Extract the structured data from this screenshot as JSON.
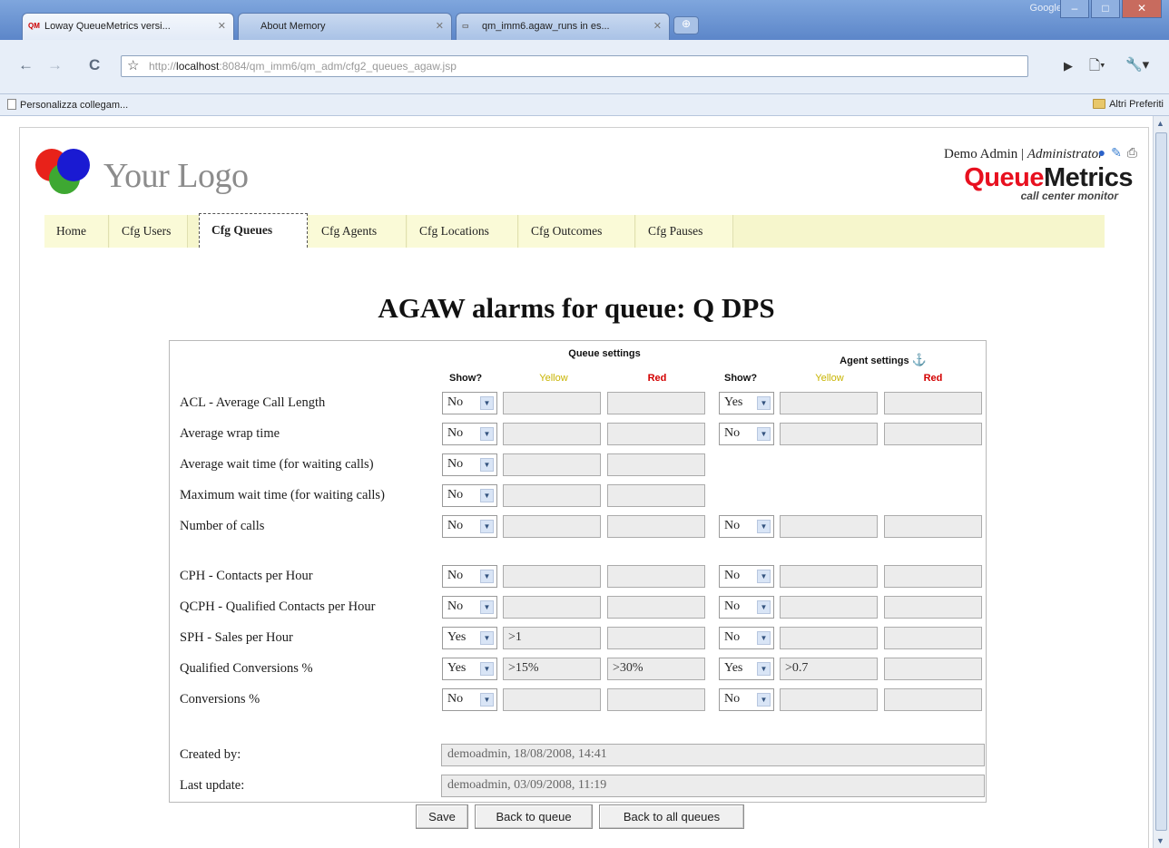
{
  "browser": {
    "tabs": [
      {
        "label": "Loway QueueMetrics versi...",
        "favicon": "QM"
      },
      {
        "label": "About Memory",
        "favicon": ""
      },
      {
        "label": "qm_imm6.agaw_runs in es...",
        "favicon": ""
      }
    ],
    "url_host": "localhost",
    "url_prefix": "http://",
    "url_rest": ":8084/qm_imm6/qm_adm/cfg2_queues_agaw.jsp",
    "brand": "Google",
    "bookmarks_left": "Personalizza collegam...",
    "bookmarks_right": "Altri Preferiti"
  },
  "header": {
    "logo_text": "Your Logo",
    "user_name": "Demo Admin",
    "separator": " | ",
    "user_role": "Administrator",
    "brand_queue": "Queue",
    "brand_metrics": "Metrics",
    "brand_sub": "call center monitor"
  },
  "nav": {
    "tabs": [
      "Home",
      "Cfg Users",
      "Cfg Queues",
      "Cfg Agents",
      "Cfg Locations",
      "Cfg Outcomes",
      "Cfg Pauses"
    ],
    "active": "Cfg Queues"
  },
  "page": {
    "title": "AGAW alarms for queue: Q DPS"
  },
  "form": {
    "queue_settings_label": "Queue settings",
    "agent_settings_label": "Agent settings",
    "show_label": "Show?",
    "yellow_label": "Yellow",
    "red_label": "Red",
    "rows": [
      {
        "label": "ACL - Average Call Length",
        "q_show": "No",
        "q_yellow": "",
        "q_red": "",
        "a_show": "Yes",
        "a_yellow": "",
        "a_red": ""
      },
      {
        "label": "Average wrap time",
        "q_show": "No",
        "q_yellow": "",
        "q_red": "",
        "a_show": "No",
        "a_yellow": "",
        "a_red": ""
      },
      {
        "label": "Average wait time (for waiting calls)",
        "q_show": "No",
        "q_yellow": "",
        "q_red": ""
      },
      {
        "label": "Maximum wait time (for waiting calls)",
        "q_show": "No",
        "q_yellow": "",
        "q_red": ""
      },
      {
        "label": "Number of calls",
        "q_show": "No",
        "q_yellow": "",
        "q_red": "",
        "a_show": "No",
        "a_yellow": "",
        "a_red": ""
      },
      {
        "label": "CPH - Contacts per Hour",
        "q_show": "No",
        "q_yellow": "",
        "q_red": "",
        "a_show": "No",
        "a_yellow": "",
        "a_red": ""
      },
      {
        "label": "QCPH - Qualified Contacts per Hour",
        "q_show": "No",
        "q_yellow": "",
        "q_red": "",
        "a_show": "No",
        "a_yellow": "",
        "a_red": ""
      },
      {
        "label": "SPH - Sales per Hour",
        "q_show": "Yes",
        "q_yellow": ">1",
        "q_red": "",
        "a_show": "No",
        "a_yellow": "",
        "a_red": ""
      },
      {
        "label": "Qualified Conversions %",
        "q_show": "Yes",
        "q_yellow": ">15%",
        "q_red": ">30%",
        "a_show": "Yes",
        "a_yellow": ">0.7",
        "a_red": ""
      },
      {
        "label": "Conversions %",
        "q_show": "No",
        "q_yellow": "",
        "q_red": "",
        "a_show": "No",
        "a_yellow": "",
        "a_red": ""
      }
    ],
    "created_by_label": "Created by:",
    "created_by_value": "demoadmin, 18/08/2008, 14:41",
    "last_update_label": "Last update:",
    "last_update_value": "demoadmin, 03/09/2008, 11:19"
  },
  "buttons": {
    "save": "Save",
    "back_to_queue": "Back to queue",
    "back_to_all": "Back to all queues"
  }
}
